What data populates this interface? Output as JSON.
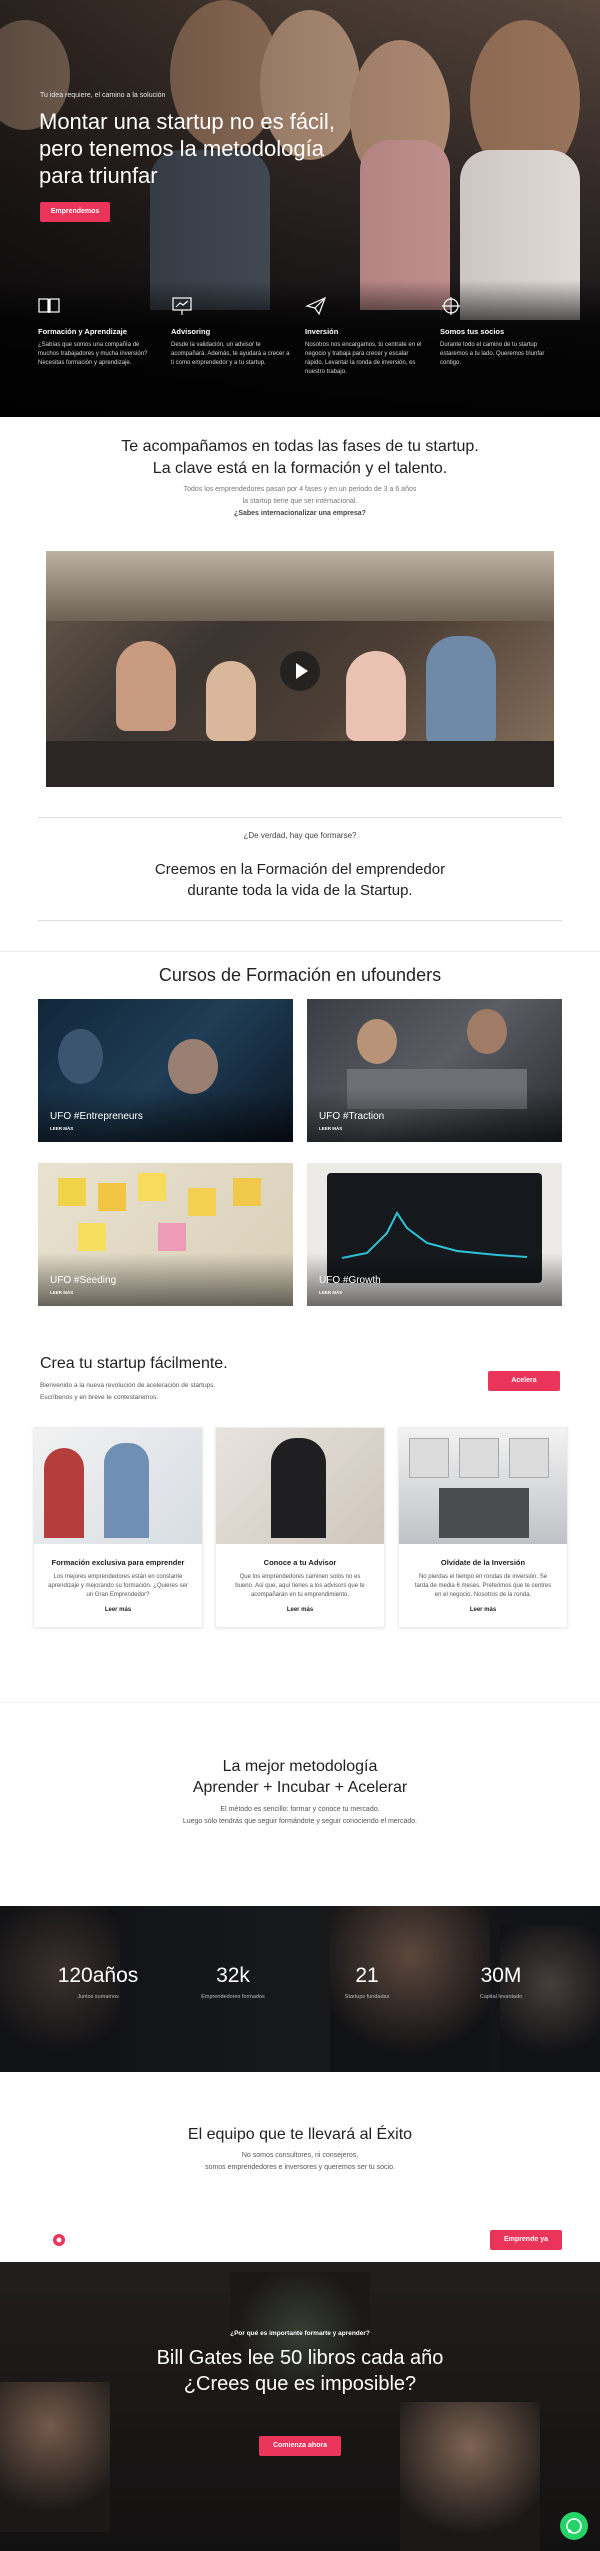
{
  "hero": {
    "kicker": "Tu idea requiere, el camino a la solución",
    "title": "Montar una startup no es fácil, pero tenemos la metodología para triunfar",
    "cta": "Emprendemos",
    "features": [
      {
        "icon": "book-icon",
        "title": "Formación y Aprendizaje",
        "desc": "¿Sabías que somos una compañía de muchos trabajadores y mucha inversión? Necesitas formación y aprendizaje."
      },
      {
        "icon": "presentation-icon",
        "title": "Advisoring",
        "desc": "Desde la validación, un advisor te acompañará. Además, te ayudará a crecer a ti como emprendedor y a tu startup."
      },
      {
        "icon": "paper-plane-icon",
        "title": "Inversión",
        "desc": "Nosotros nos encargamos, tú centrate en el negocio y trabaja para crecer y escalar rápido. Levantar la ronda de inversión, es nuestro trabajo."
      },
      {
        "icon": "crosshair-icon",
        "title": "Somos tus socios",
        "desc": "Durante todo el camino de tu startup estaremos a tu lado. Queremos triunfar contigo."
      }
    ]
  },
  "phases": {
    "title_line1": "Te acompañamos en todas las fases de tu startup.",
    "title_line2": "La clave está en la formación y el talento.",
    "sub_line1": "Todos los emprendedores pasan por 4 fases y en un periodo de 3 a 6 años",
    "sub_line2": "la startup tiene que ser internacional.",
    "question": "¿Sabes internacionalizar una empresa?"
  },
  "video": {
    "play_icon": "play-icon"
  },
  "formation": {
    "question": "¿De verdad, hay que formarse?",
    "title_line1": "Creemos en la Formación del emprendedor",
    "title_line2": "durante toda la vida de la Startup."
  },
  "courses": {
    "title": "Cursos de Formación en ufounders",
    "items": [
      {
        "label": "UFO #Entrepreneurs",
        "more": "LEER MÁS"
      },
      {
        "label": "UFO #Traction",
        "more": "LEER MÁS"
      },
      {
        "label": "UFO #Seeding",
        "more": "LEER MÁS"
      },
      {
        "label": "UFO #Growth",
        "more": "LEER MÁS"
      }
    ]
  },
  "create": {
    "title": "Crea tu startup fácilmente.",
    "sub_line1": "Bienvenido a la nueva revolución de aceleración de startups.",
    "sub_line2": "Escríbenos y en breve te contestaremos.",
    "button": "Acelera",
    "cards": [
      {
        "title": "Formación exclusiva para emprender",
        "desc": "Los mejores emprendedores están en constante aprendizaje y mejorando su formación. ¿Quieres ser un Gran Emprendedor?",
        "more": "Leer más"
      },
      {
        "title": "Conoce a tu Advisor",
        "desc": "Que los emprendedores caminen solos no es bueno. Así que, aquí tienes a los advisors que te acompañarán en tu emprendimiento.",
        "more": "Leer más"
      },
      {
        "title": "Olvídate de la Inversión",
        "desc": "No pierdas el tiempo en rondas de inversión. Se tarda de media 6 meses. Preferimos que te centres en el negocio. Nosotros de la ronda.",
        "more": "Leer más"
      }
    ]
  },
  "method": {
    "title_line1": "La mejor metodología",
    "title_line2": "Aprender + Incubar + Acelerar",
    "sub_line1": "El método es sencillo: formar y conoce tu mercado.",
    "sub_line2": "Luego sólo tendrás que seguir formándote y seguir conociendo el mercado."
  },
  "stats": [
    {
      "value": "120años",
      "label": "Juntos sumamos"
    },
    {
      "value": "32k",
      "label": "Emprendedores formados"
    },
    {
      "value": "21",
      "label": "Startups fundadas"
    },
    {
      "value": "30M",
      "label": "Capital levantado"
    }
  ],
  "team": {
    "title": "El equipo que te llevará al Éxito",
    "sub_line1": "No somos consultores, ni consejeros,",
    "sub_line2": "somos emprendedores e inversores y queremos ser tu socio.",
    "logo_icon": "ufo-logo-icon",
    "button": "Emprende ya"
  },
  "cta": {
    "kicker": "¿Por qué es importante formarte y aprender?",
    "title_line1": "Bill Gates lee 50 libros cada año",
    "title_line2": "¿Crees que es imposible?",
    "button": "Comienza ahora",
    "whatsapp_icon": "whatsapp-icon"
  },
  "colors": {
    "accent": "#ea3459",
    "dark": "#1d1b1c"
  }
}
